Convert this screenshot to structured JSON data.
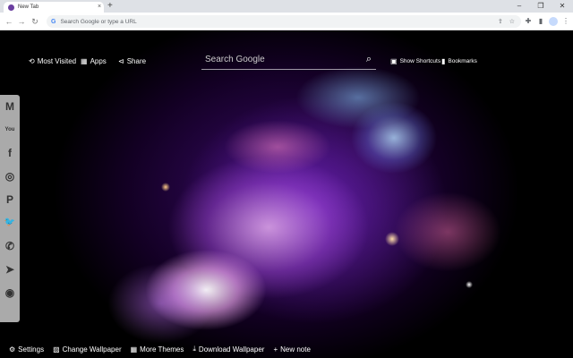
{
  "browser": {
    "tab_title": "New Tab",
    "tab_close": "×",
    "new_tab": "+",
    "omnibox_placeholder": "Search Google or type a URL",
    "win_min": "–",
    "win_max": "❐",
    "win_close": "✕"
  },
  "top": {
    "most_visited": "Most Visited",
    "apps": "Apps",
    "share": "Share",
    "search_placeholder": "Search Google",
    "show_shortcuts": "Show Shortcuts",
    "bookmarks": "Bookmarks"
  },
  "social": [
    {
      "name": "gmail-icon",
      "glyph": "M"
    },
    {
      "name": "youtube-icon",
      "glyph": "You"
    },
    {
      "name": "facebook-icon",
      "glyph": "f"
    },
    {
      "name": "instagram-icon",
      "glyph": "◎"
    },
    {
      "name": "pinterest-icon",
      "glyph": "P"
    },
    {
      "name": "twitter-icon",
      "glyph": "🐦"
    },
    {
      "name": "whatsapp-icon",
      "glyph": "✆"
    },
    {
      "name": "telegram-icon",
      "glyph": "➤"
    },
    {
      "name": "reddit-icon",
      "glyph": "◉"
    }
  ],
  "bottom": {
    "settings": "Settings",
    "change_wallpaper": "Change Wallpaper",
    "more_themes": "More Themes",
    "download_wallpaper": "Download Wallpaper",
    "new_note": "New note"
  },
  "colors": {
    "accent": "#6b3fa0",
    "chrome_bg": "#dee1e6",
    "sidebar_bg": "#aaaaaa"
  }
}
